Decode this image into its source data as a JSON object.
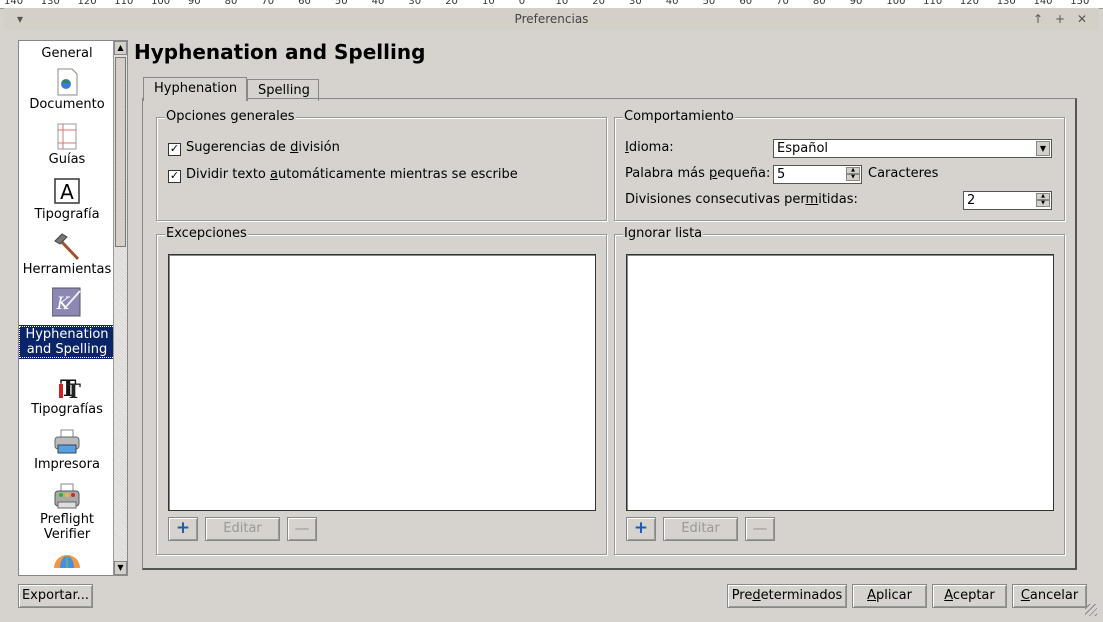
{
  "ruler_marks": [
    "140",
    "130",
    "120",
    "110",
    "100",
    "90",
    "80",
    "70",
    "60",
    "50",
    "40",
    "30",
    "20",
    "10",
    "0",
    "10",
    "20",
    "30",
    "40",
    "50",
    "60",
    "70",
    "80",
    "90",
    "100",
    "110",
    "120",
    "130",
    "140",
    "150"
  ],
  "window": {
    "title": "Preferencias",
    "controls": {
      "up": "↑",
      "plus": "+",
      "close": "✕"
    }
  },
  "sidebar": {
    "items": [
      {
        "label": "General",
        "icon": "general"
      },
      {
        "label": "Documento",
        "icon": "document-icon"
      },
      {
        "label": "Guías",
        "icon": "guides-icon"
      },
      {
        "label": "Tipografía",
        "icon": "typography-icon"
      },
      {
        "label": "Herramientas",
        "icon": "tools-hammer-icon"
      },
      {
        "label_line1": "Hyphenation",
        "label_line2": "and Spelling",
        "icon": "hyphenation-quill-icon",
        "selected": true
      },
      {
        "label": "Tipografías",
        "icon": "fonts-icon"
      },
      {
        "label": "Impresora",
        "icon": "printer-icon"
      },
      {
        "label_line1": "Preflight",
        "label_line2": "Verifier",
        "icon": "preflight-icon"
      },
      {
        "label": "",
        "icon": "umbrella-icon"
      }
    ]
  },
  "page": {
    "heading": "Hyphenation and Spelling",
    "tabs": [
      {
        "label": "Hyphenation",
        "active": true
      },
      {
        "label": "Spelling",
        "active": false
      }
    ]
  },
  "general_options": {
    "legend": "Opciones generales",
    "suggestions": {
      "label_pre": "Sugerencias de ",
      "label_u": "d",
      "label_post": "ivisión",
      "checked": true
    },
    "auto_hyphen": {
      "label_pre": "Dividir texto ",
      "label_u": "a",
      "label_post": "utomáticamente mientras se escribe",
      "checked": true
    }
  },
  "behaviour": {
    "legend": "Comportamiento",
    "language_label_u": "I",
    "language_label_rest": "dioma:",
    "language_value": "Español",
    "smallest_word_label_pre": "Palabra más ",
    "smallest_word_label_u": "p",
    "smallest_word_label_post": "equeña:",
    "smallest_word_value": "5",
    "smallest_word_unit": "Caracteres",
    "consecutive_label_pre": "Divisiones consecutivas per",
    "consecutive_label_u": "m",
    "consecutive_label_post": "itidas:",
    "consecutive_value": "2"
  },
  "exceptions": {
    "legend": "Excepciones",
    "add_icon": "plus-icon",
    "edit_label": "Editar",
    "remove_icon": "minus-icon"
  },
  "ignore_list": {
    "legend": "Ignorar lista",
    "add_icon": "plus-icon",
    "edit_label": "Editar",
    "remove_icon": "minus-icon"
  },
  "footer": {
    "export": "Exportar...",
    "defaults_pre": "Pre",
    "defaults_u": "d",
    "defaults_post": "eterminados",
    "apply_u": "A",
    "apply_post": "plicar",
    "accept_u": "A",
    "accept_post": "ceptar",
    "cancel_u": "C",
    "cancel_post": "ancelar"
  }
}
